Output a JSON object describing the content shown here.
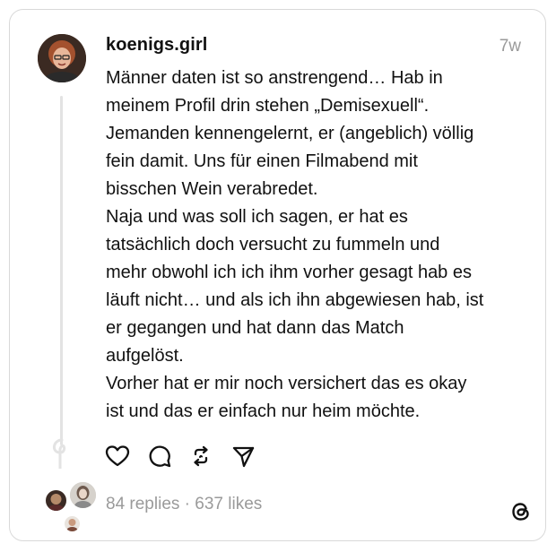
{
  "post": {
    "username": "koenigs.girl",
    "time": "7w",
    "lines": [
      "Männer daten ist so anstrengend… Hab in",
      "meinem Profil drin stehen „Demisexuell“.",
      "Jemanden kennengelernt, er (angeblich) völlig",
      "fein damit. Uns für einen Filmabend mit",
      "bisschen Wein verabredet.",
      "Naja und was soll ich sagen, er hat es",
      "tatsächlich doch versucht zu fummeln und",
      "mehr obwohl ich ich ihm vorher gesagt hab es",
      "läuft nicht… und als ich ihn abgewiesen hab, ist",
      "er gegangen und hat dann das Match",
      "aufgelöst.",
      "Vorher hat er mir noch versichert das es okay",
      "ist und das er einfach nur heim möchte."
    ]
  },
  "actions": [
    {
      "name": "like-button",
      "icon": "heart-icon"
    },
    {
      "name": "reply-button",
      "icon": "comment-icon"
    },
    {
      "name": "repost-button",
      "icon": "repost-icon"
    },
    {
      "name": "share-button",
      "icon": "send-icon"
    }
  ],
  "stats": {
    "text": "84 replies · 637 likes"
  },
  "colors": {
    "text": "#111111",
    "muted": "#9a9a9a",
    "border": "#d9d9d9",
    "thread_line": "#e3e3e3"
  }
}
